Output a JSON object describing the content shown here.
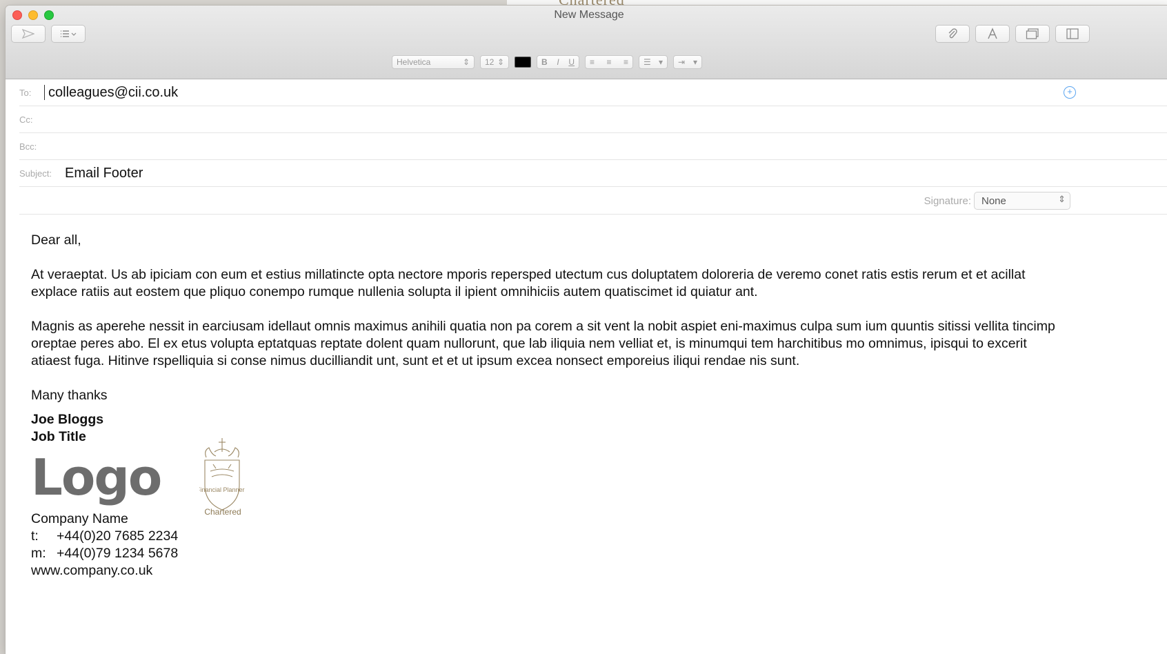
{
  "background": {
    "chartered_fragment": "Chartered"
  },
  "window": {
    "title": "New Message"
  },
  "toolbar": {
    "send_icon": "send-icon",
    "header_icon": "list-icon",
    "attach_icon": "paperclip-icon",
    "format_icon": "format-text-icon",
    "photo_icon": "photo-browser-icon",
    "panel_icon": "panel-icon"
  },
  "format_bar": {
    "font": "Helvetica",
    "size": "12",
    "color": "#000000",
    "styles": [
      "B",
      "I",
      "U"
    ]
  },
  "fields": {
    "to_label": "To:",
    "to_value": "colleagues@cii.co.uk",
    "cc_label": "Cc:",
    "bcc_label": "Bcc:",
    "subject_label": "Subject:",
    "subject_value": "Email Footer"
  },
  "signature_selector": {
    "label": "Signature:",
    "value": "None"
  },
  "message": {
    "greeting": "Dear all,",
    "paragraph1": "At veraeptat. Us ab ipiciam con eum et estius millatincte opta nectore mporis repersped utectum cus doluptatem doloreria de veremo conet ratis estis rerum et et acillat explace ratiis aut eostem que pliquo conempo rumque nullenia solupta il ipient omnihiciis autem quatiscimet id quiatur ant.",
    "paragraph2": "Magnis as aperehe nessit in earciusam idellaut omnis maximus anihili quatia non pa corem a sit vent la nobit aspiet eni-maximus culpa sum ium quuntis sitissi vellita tincimp oreptae peres abo. El ex etus volupta eptatquas reptate dolent quam nullorunt, que lab iliquia nem velliat et, is minumqui tem harchitibus mo omnimus, ipisqui to excerit atiaest fuga. Hitinve rspelliquia si conse nimus ducilliandit unt, sunt et et ut ipsum excea nonsect emporeius iliqui rendae nis sunt.",
    "signoff": "Many thanks"
  },
  "signature": {
    "name": "Joe Bloggs",
    "job_title": "Job Title",
    "logo_text": "Logo",
    "crest_text": "Financial Planners",
    "crest_caption": "Chartered",
    "company": "Company Name",
    "tel_label": "t:",
    "tel": "+44(0)20 7685 2234",
    "mobile_label": "m:",
    "mobile": "+44(0)79 1234 5678",
    "website": "www.company.co.uk"
  }
}
